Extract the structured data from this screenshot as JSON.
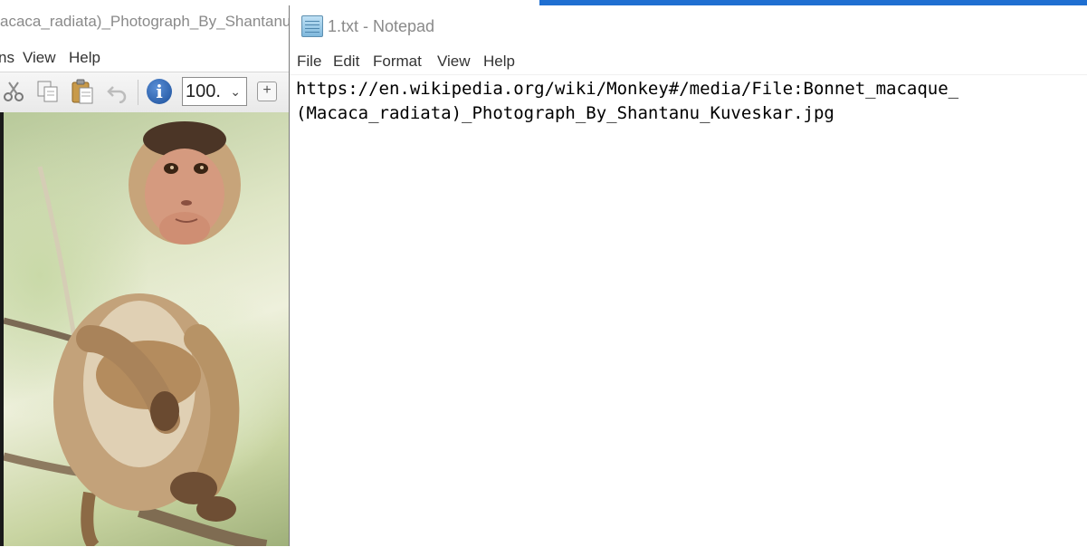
{
  "viewer": {
    "title": "acaca_radiata)_Photograph_By_Shantanu_",
    "menu": [
      "ns",
      "View",
      "Help"
    ],
    "toolbar": {
      "icons": [
        "scissors-icon",
        "copy-icon",
        "paste-icon",
        "undo-icon",
        "info-icon"
      ],
      "info_label": "i",
      "zoom_value": "100.",
      "zoom_plus": "+"
    }
  },
  "notepad": {
    "title": "1.txt - Notepad",
    "menu": [
      "File",
      "Edit",
      "Format",
      "View",
      "Help"
    ],
    "content_lines": [
      "https://en.wikipedia.org/wiki/Monkey#/media/File:Bonnet_macaque_",
      "(Macaca_radiata)_Photograph_By_Shantanu_Kuveskar.jpg"
    ]
  },
  "colors": {
    "accent": "#1f6fd1",
    "title_text": "#8a8a8a"
  }
}
